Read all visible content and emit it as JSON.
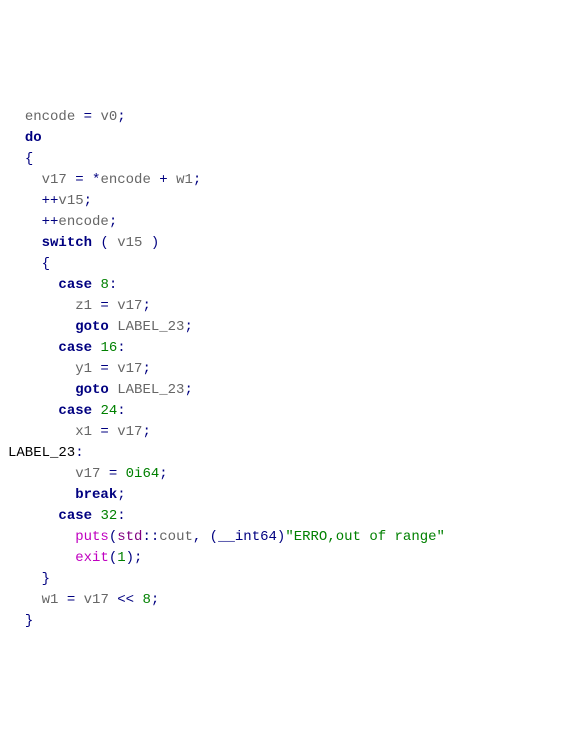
{
  "code": {
    "l0_a": "encode",
    "l0_b": " = ",
    "l0_c": "v0",
    "l0_d": ";",
    "l1": "do",
    "l2": "{",
    "l3_a": "v17",
    "l3_b": " = *",
    "l3_c": "encode",
    "l3_d": " + ",
    "l3_e": "w1",
    "l3_f": ";",
    "l4_a": "++",
    "l4_b": "v15",
    "l4_c": ";",
    "l5_a": "++",
    "l5_b": "encode",
    "l5_c": ";",
    "l6_a": "switch",
    "l6_b": " ( ",
    "l6_c": "v15",
    "l6_d": " )",
    "l7": "{",
    "l8_a": "case",
    "l8_b": " ",
    "l8_c": "8",
    "l8_d": ":",
    "l9_a": "z1",
    "l9_b": " = ",
    "l9_c": "v17",
    "l9_d": ";",
    "l10_a": "goto",
    "l10_b": " ",
    "l10_c": "LABEL_23",
    "l10_d": ";",
    "l11_a": "case",
    "l11_b": " ",
    "l11_c": "16",
    "l11_d": ":",
    "l12_a": "y1",
    "l12_b": " = ",
    "l12_c": "v17",
    "l12_d": ";",
    "l13_a": "goto",
    "l13_b": " ",
    "l13_c": "LABEL_23",
    "l13_d": ";",
    "l14_a": "case",
    "l14_b": " ",
    "l14_c": "24",
    "l14_d": ":",
    "l15_a": "x1",
    "l15_b": " = ",
    "l15_c": "v17",
    "l15_d": ";",
    "l16_a": "LABEL_23",
    "l16_b": ":",
    "l17_a": "v17",
    "l17_b": " = ",
    "l17_c": "0i64",
    "l17_d": ";",
    "l18": "break",
    "l18_b": ";",
    "l19_a": "case",
    "l19_b": " ",
    "l19_c": "32",
    "l19_d": ":",
    "l20_a": "puts",
    "l20_b": "(",
    "l20_c": "std",
    "l20_d": "::",
    "l20_e": "cout",
    "l20_f": ", (",
    "l20_g": "__int64",
    "l20_h": ")",
    "l20_i": "\"ERRO,out of range\"",
    "l21_a": "exit",
    "l21_b": "(",
    "l21_c": "1",
    "l21_d": ");",
    "l22": "}",
    "l23_a": "w1",
    "l23_b": " = ",
    "l23_c": "v17",
    "l23_d": " << ",
    "l23_e": "8",
    "l23_f": ";",
    "l24": "}"
  }
}
